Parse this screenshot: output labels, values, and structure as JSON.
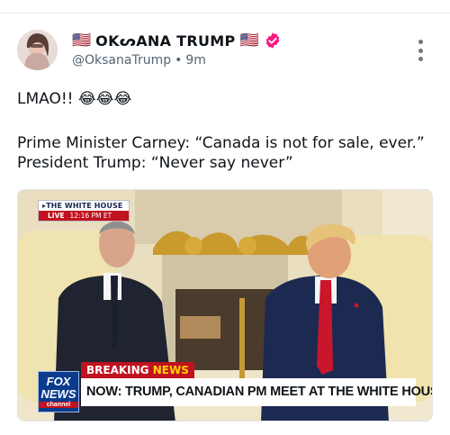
{
  "author": {
    "flag_left": "🇺🇸",
    "display_name": "OKᔕANA TRUMP",
    "flag_right": "🇺🇸",
    "verified_icon": "verified-badge-icon",
    "handle": "@OksanaTrump",
    "separator": "•",
    "time": "9m",
    "avatar": "avatar-photo"
  },
  "post": {
    "line1_text": "LMAO!!",
    "line1_emoji": "😂😂😂",
    "line2": "Prime Minister Carney: “Canada is not for sale, ever.”",
    "line3": "President Trump: “Never say never”"
  },
  "media": {
    "badge_title": "▸THE WHITE HOUSE",
    "badge_live": "LIVE",
    "badge_time": "12:16 PM ET",
    "breaking_label": "BREAKING",
    "breaking_news": "NEWS",
    "headline": "NOW: TRUMP, CANADIAN PM MEET AT THE WHITE HOUSE",
    "network_line1": "FOX",
    "network_line2": "NEWS",
    "network_line3": "channel"
  },
  "colors": {
    "accent_verified": "#f91880",
    "fox_red": "#c1121f",
    "fox_blue": "#0b3b8c"
  },
  "more_icon": "more-vertical-icon"
}
